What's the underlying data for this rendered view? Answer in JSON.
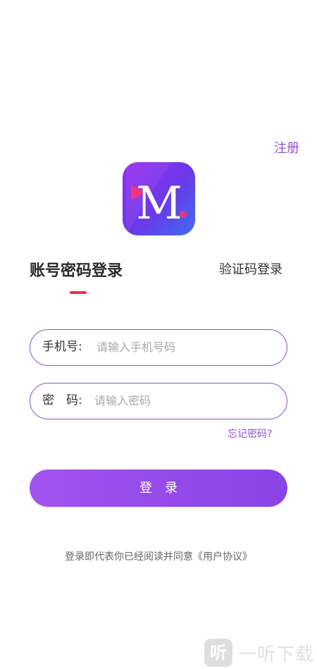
{
  "header": {
    "register_link": "注册"
  },
  "logo": {
    "letter": "M",
    "dot": "."
  },
  "tabs": {
    "password_login": "账号密码登录",
    "code_login": "验证码登录"
  },
  "form": {
    "phone_label": "手机号:",
    "phone_placeholder": "请输入手机号码",
    "password_label": "密　码:",
    "password_placeholder": "请输入密码",
    "forgot_password": "忘记密码?",
    "login_button": "登　录"
  },
  "agreement": "登录即代表你已经阅读并同意《用户协议》",
  "watermark": {
    "icon_glyph": "听",
    "text": "一听下载"
  },
  "colors": {
    "accent": "#8e4fd6",
    "button_start": "#a254ee",
    "button_end": "#8a43e6",
    "tab_indicator": "#e9304f",
    "logo_pink": "#f0357a"
  }
}
